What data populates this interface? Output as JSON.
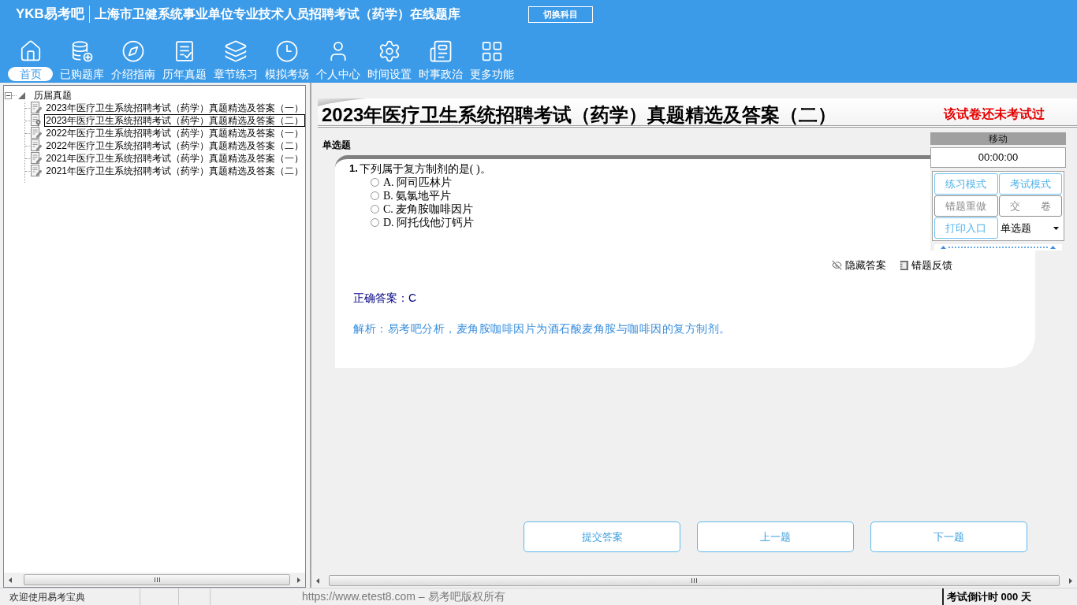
{
  "header": {
    "logo": "YKB易考吧",
    "title": "上海市卫健系统事业单位专业技术人员招聘考试（药学）在线题库",
    "switch_button": "切换科目"
  },
  "nav": [
    {
      "label": "首页",
      "selected": true
    },
    {
      "label": "已购题库",
      "selected": false
    },
    {
      "label": "介绍指南",
      "selected": false
    },
    {
      "label": "历年真题",
      "selected": false
    },
    {
      "label": "章节练习",
      "selected": false
    },
    {
      "label": "模拟考场",
      "selected": false
    },
    {
      "label": "个人中心",
      "selected": false
    },
    {
      "label": "时间设置",
      "selected": false
    },
    {
      "label": "时事政治",
      "selected": false
    },
    {
      "label": "更多功能",
      "selected": false
    }
  ],
  "tree": {
    "label": "历届真题",
    "expanded": true,
    "children": [
      {
        "label": "2023年医疗卫生系统招聘考试（药学）真题精选及答案（一）",
        "selected": false
      },
      {
        "label": "2023年医疗卫生系统招聘考试（药学）真题精选及答案（二）",
        "selected": true
      },
      {
        "label": "2022年医疗卫生系统招聘考试（药学）真题精选及答案（一）",
        "selected": false
      },
      {
        "label": "2022年医疗卫生系统招聘考试（药学）真题精选及答案（二）",
        "selected": false
      },
      {
        "label": "2021年医疗卫生系统招聘考试（药学）真题精选及答案（一）",
        "selected": false
      },
      {
        "label": "2021年医疗卫生系统招聘考试（药学）真题精选及答案（二）",
        "selected": false
      }
    ]
  },
  "exam": {
    "title": "2023年医疗卫生系统招聘考试（药学）真题精选及答案（二）",
    "status": "该试卷还未考试过",
    "section": "单选题",
    "question": {
      "number": "1.",
      "text": "下列属于复方制剂的是( )。",
      "options": [
        {
          "text": "A. 阿司匹林片",
          "selected": false
        },
        {
          "text": "B. 氨氯地平片",
          "selected": false
        },
        {
          "text": "C. 麦角胺咖啡因片",
          "selected": false
        },
        {
          "text": "D. 阿托伐他汀钙片",
          "selected": false
        }
      ]
    },
    "actions": [
      "隐藏答案",
      "错题反馈"
    ],
    "answer": "正确答案：C",
    "analysis": "解析：易考吧分析，麦角胺咖啡因片为酒石酸麦角胺与咖啡因的复方制剂。"
  },
  "control_panel": {
    "title": "移动",
    "timer": "00:00:00",
    "buttons": [
      {
        "label": "练习模式",
        "disabled": false
      },
      {
        "label": "考试模式",
        "disabled": false
      },
      {
        "label": "错题重做",
        "disabled": true
      },
      {
        "label": "交　　卷",
        "disabled": true
      },
      {
        "label": "打印入口",
        "disabled": false
      }
    ],
    "type_select": "单选题"
  },
  "bottom_buttons": [
    "提交答案",
    "上一题",
    "下一题"
  ],
  "status_bar": {
    "welcome": "欢迎使用易考宝典",
    "copyright": "https://www.etest8.com – 易考吧版权所有",
    "countdown": "考试倒计时 000 天"
  }
}
